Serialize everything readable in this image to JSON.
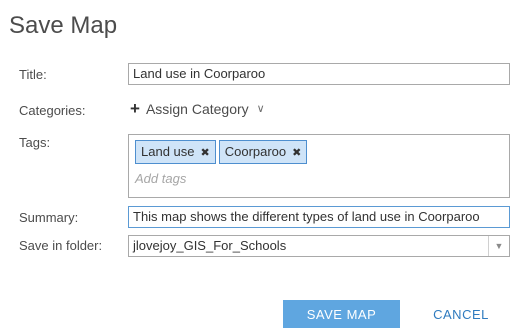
{
  "dialog": {
    "title": "Save Map"
  },
  "form": {
    "title_label": "Title:",
    "title_value": "Land use in Coorparoo",
    "categories_label": "Categories:",
    "assign_category_label": "Assign Category",
    "tags_label": "Tags:",
    "tags": [
      "Land use",
      "Coorparoo"
    ],
    "tag_remove_glyph": "✖",
    "tags_placeholder": "Add tags",
    "summary_label": "Summary:",
    "summary_value": "This map shows the different types of land use in Coorparoo",
    "folder_label": "Save in folder:",
    "folder_value": "jlovejoy_GIS_For_Schools"
  },
  "buttons": {
    "save": "SAVE MAP",
    "cancel": "CANCEL"
  },
  "colors": {
    "primary_button": "#5fa6e0",
    "link_blue": "#2f7bbf",
    "chip_fill": "#cfe4f8",
    "chip_border": "#4e8fcf"
  },
  "icons": {
    "add": "plus-icon",
    "expand": "chevron-down-icon",
    "remove_tag": "close-icon",
    "dropdown": "triangle-down-icon"
  }
}
